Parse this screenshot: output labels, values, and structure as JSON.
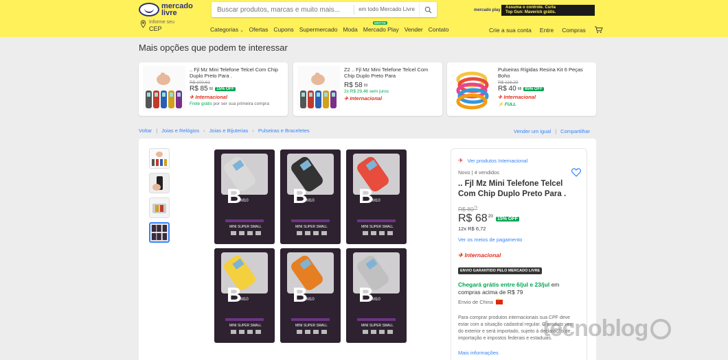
{
  "header": {
    "logo_line1": "mercado",
    "logo_line2": "livre",
    "search_placeholder": "Buscar produtos, marcas e muito mais...",
    "search_scope": "em todo Mercado Livre",
    "banner_left": "mercado play",
    "banner_text_1": "Assuma o controle. Curta",
    "banner_text_2": "Top Gun: Maverick grátis.",
    "location_label": "Informe seu",
    "location_value": "CEP",
    "nav": [
      "Categorias",
      "Ofertas",
      "Cupons",
      "Supermercado",
      "Moda",
      "Mercado Play",
      "Vender",
      "Contato"
    ],
    "nav_badge": "GRÁTIS",
    "right_nav": [
      "Crie a sua conta",
      "Entre",
      "Compras"
    ]
  },
  "suggestions": {
    "title": "Mais opções que podem te interessar",
    "cards": [
      {
        "title": ".. Fjl Mz Mini Telefone Telcel Com Chip Duplo Preto Para .",
        "old_price": "R$ 100,61",
        "price": "R$ 85",
        "cents": "50",
        "discount": "15% OFF",
        "installments": "",
        "badge": "Internacional",
        "shipping_strong": "Frete grátis",
        "shipping_rest": " por ser sua primeira compra"
      },
      {
        "title": "Z2 .. Fjl Mz Mini Telefone Telcel Com Chip Duplo Preto Para",
        "old_price": "",
        "price": "R$ 58",
        "cents": "93",
        "discount": "",
        "installments": "2x R$ 29,46 sem juros",
        "badge": "Internacional",
        "shipping_strong": "",
        "shipping_rest": ""
      },
      {
        "title": "Pulseiras Rígidas Resina Kit 6 Peças Boho",
        "old_price": "R$ 116,29",
        "price": "R$ 40",
        "cents": "68",
        "discount": "65% OFF",
        "installments": "",
        "badge": "Internacional",
        "shipping_strong": "",
        "shipping_rest": "",
        "full": "FULL"
      }
    ]
  },
  "breadcrumb": {
    "items": [
      "Voltar",
      "Joias e Relógios",
      "Joias e Bijuterias",
      "Pulseiras e Braceletes"
    ],
    "right": [
      "Vender um igual",
      "Compartilhar"
    ]
  },
  "product": {
    "intl_link": "Ver produtos Internacional",
    "condition": "Novo",
    "sold": "4 vendidos",
    "title": ".. Fjl Mz Mini Telefone Telcel Com Chip Duplo Preto Para .",
    "old_price": "R$ 80",
    "old_cents": "79",
    "price": "R$ 68",
    "cents": "20",
    "discount": "15% OFF",
    "installments": "12x R$ 6,72",
    "payment_link": "Ver os meios de pagamento",
    "intl_badge": "Internacional",
    "env_badge": "ENVIO GARANTIDO PELO MERCADO LIVRE",
    "ship_strong": "Chegará grátis entre 6/jul e 23/jul",
    "ship_rest": " em compras acima de R$ 79",
    "ship_from": "Envio de China",
    "info_text": "Para comprar produtos internacionais sua CPF deve estar com a situação cadastral regular. O produto vem do exterior e será importado, sujeito à declaração de importação e impostos federais e estaduais.",
    "more_link": "Mais informações",
    "phone_label_1": "M10",
    "phone_label_2": "MINI SUPER SMALL",
    "box_letter": "B"
  },
  "watermark": "tecnoblog"
}
